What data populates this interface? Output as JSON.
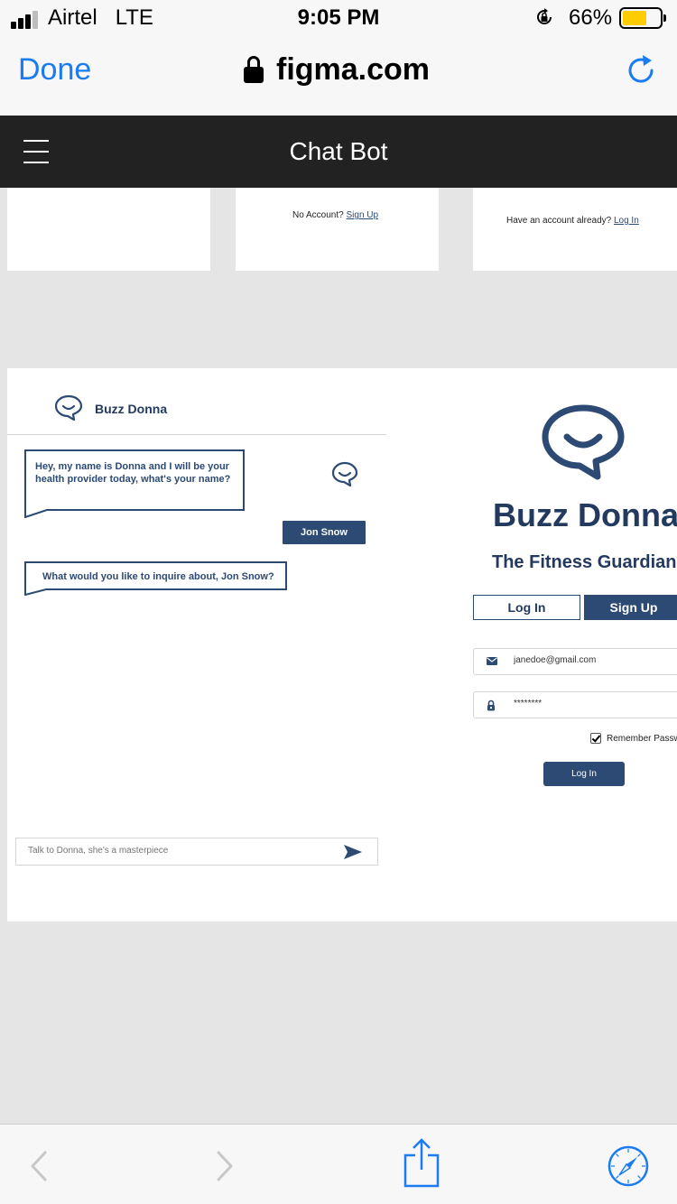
{
  "status_bar": {
    "carrier": "Airtel",
    "network": "LTE",
    "time": "9:05 PM",
    "battery_pct": "66%",
    "battery_level": 0.66,
    "battery_color": "#ffcc00"
  },
  "browser": {
    "done_label": "Done",
    "url": "figma.com",
    "accent": "#1a7cf0",
    "icons": [
      "padlock-icon",
      "reload-icon"
    ]
  },
  "app": {
    "title": "Chat Bot",
    "header_color": "#222222"
  },
  "top_cards": {
    "signup_prompt": "No Account?",
    "signup_link": "Sign Up",
    "login_prompt": "Have an account already?",
    "login_link": "Log In"
  },
  "chat": {
    "bot_name": "Buzz Donna",
    "messages": [
      {
        "from": "bot",
        "text": "Hey, my name is Donna and I will be your health provider today, what's your name?"
      },
      {
        "from": "user",
        "text": "Jon Snow"
      },
      {
        "from": "bot",
        "text": "What would you like to inquire about, Jon Snow?"
      }
    ],
    "input_placeholder": "Talk to Donna, she's a masterpiece",
    "brand_color": "#2c4a73"
  },
  "login": {
    "brand_title": "Buzz Donna",
    "brand_subtitle": "The Fitness Guardian",
    "tab_login": "Log In",
    "tab_signup": "Sign Up",
    "email_value": "janedoe@gmail.com",
    "password_value": "********",
    "remember_label": "Remember Passw",
    "remember_checked": true,
    "submit_label": "Log In"
  },
  "toolbar": {
    "icons": [
      "back-icon",
      "forward-icon",
      "share-icon",
      "safari-compass-icon"
    ]
  }
}
